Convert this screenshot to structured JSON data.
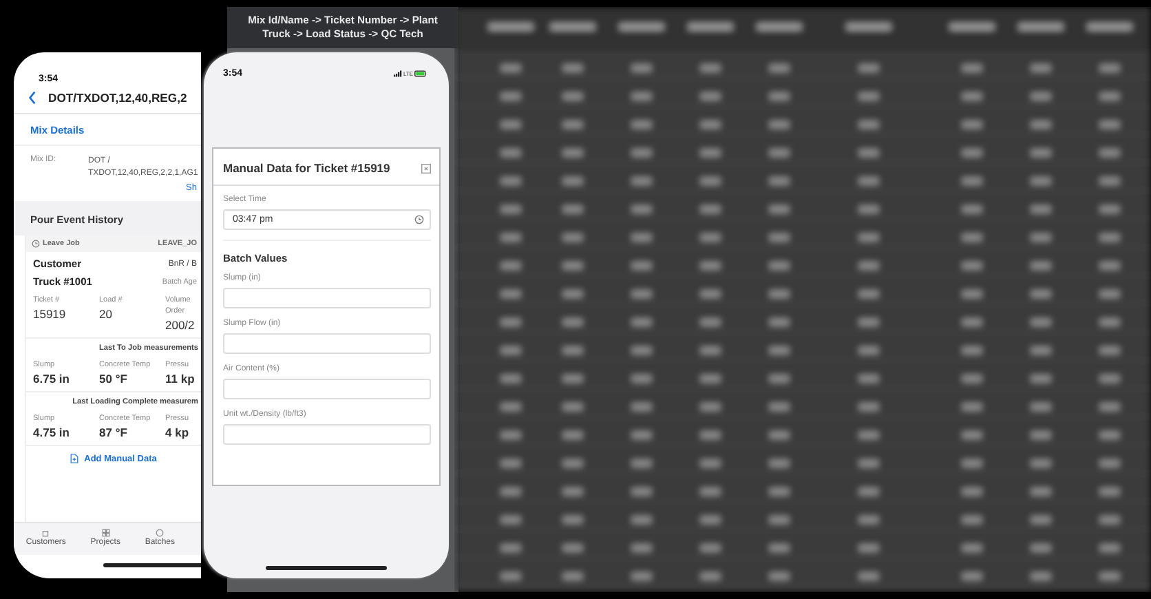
{
  "overlay_header": {
    "lines": [
      "Mix Id/Name -> Ticket Number -> Plant",
      "Truck -> Load Status -> QC Tech"
    ]
  },
  "left_phone": {
    "time": "3:54",
    "title": "DOT/TXDOT,12,40,REG,2",
    "section": "Mix Details",
    "mix_id_label": "Mix ID:",
    "mix_id_value": "DOT / TXDOT,12,40,REG,2,2,1,AG1",
    "show_link": "Sh",
    "history_title": "Pour Event History",
    "event": {
      "type": "Leave Job",
      "code": "LEAVE_JO",
      "customer": "Customer",
      "customer_value": "BnR / B",
      "truck": "Truck #1001",
      "batch_age": "Batch Age",
      "fields": [
        {
          "label": "Ticket #",
          "value": "15919"
        },
        {
          "label": "Load #",
          "value": "20"
        },
        {
          "label": "Volume",
          "sublabel": "Order",
          "value": "200/2"
        }
      ],
      "measurement_groups": [
        {
          "title": "Last To Job measurements",
          "items": [
            {
              "label": "Slump",
              "value": "6.75 in"
            },
            {
              "label": "Concrete Temp",
              "value": "50 °F"
            },
            {
              "label": "Pressu",
              "value": "11 kp"
            }
          ]
        },
        {
          "title": "Last Loading Complete measurem",
          "items": [
            {
              "label": "Slump",
              "value": "4.75 in"
            },
            {
              "label": "Concrete Temp",
              "value": "87 °F"
            },
            {
              "label": "Pressu",
              "value": "4 kp"
            }
          ]
        }
      ],
      "action": "Add Manual Data"
    },
    "tabs": [
      {
        "label": "Customers",
        "kind": "customers"
      },
      {
        "label": "Projects",
        "kind": "projects"
      },
      {
        "label": "Batches",
        "kind": "batches"
      }
    ]
  },
  "right_phone": {
    "time": "3:54",
    "network": "LTE",
    "modal": {
      "title": "Manual Data for Ticket #15919",
      "time_label": "Select Time",
      "time_value": "03:47 pm",
      "section": "Batch Values",
      "fields": [
        {
          "label": "Slump (in)"
        },
        {
          "label": "Slump Flow (in)"
        },
        {
          "label": "Air Content (%)"
        },
        {
          "label": "Unit wt./Density (lb/ft3)"
        }
      ]
    }
  }
}
